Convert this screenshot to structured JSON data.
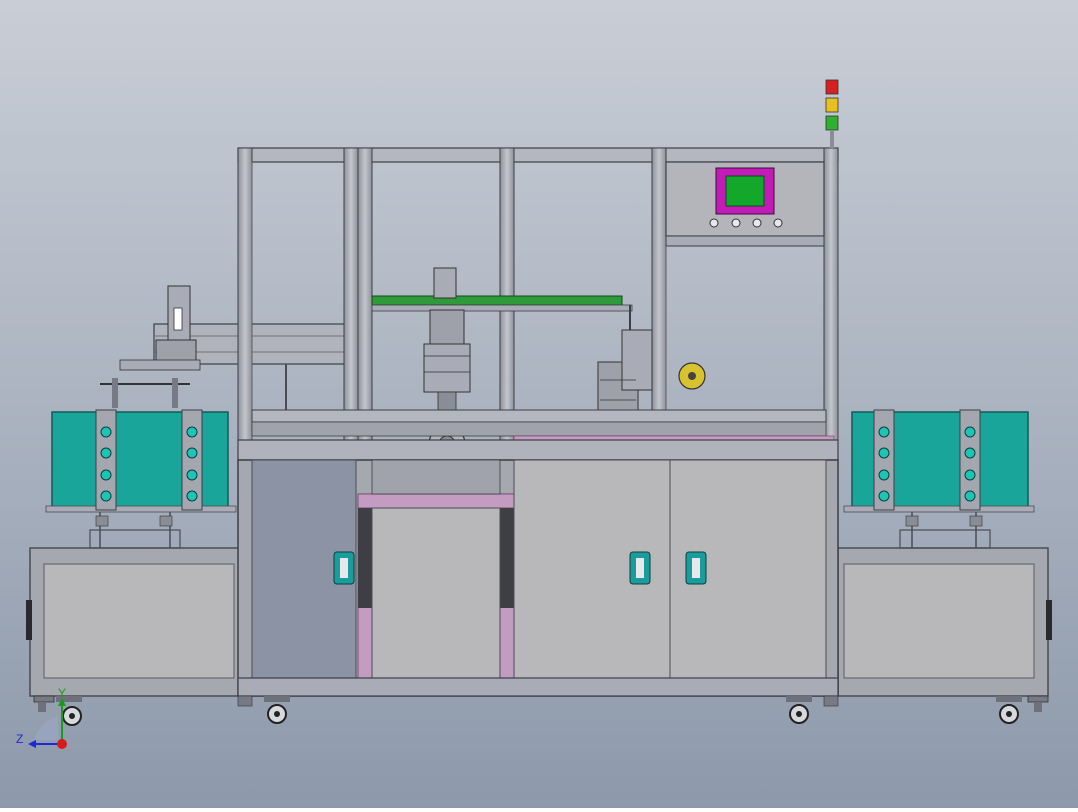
{
  "viewport": {
    "background_top": "#c9ced6",
    "background_bottom": "#8d99ab"
  },
  "colors": {
    "frame": "#a9acb6",
    "frame_dark": "#5a5d66",
    "panel_gray": "#b7b7b9",
    "panel_blue_gray": "#8c93a5",
    "teal_bin": "#1aa59b",
    "magenta": "#c21bb8",
    "screen_green": "#13a82b",
    "conveyor_green": "#2f9a3a",
    "pink_trim": "#c49bc1",
    "handle_teal": "#1a9c9c",
    "tape_yellow": "#d8c22e"
  },
  "hmi": {
    "screen": "green-screen",
    "buttons": 4
  },
  "signal_tower": {
    "lights": [
      "red",
      "yellow",
      "green"
    ],
    "light_colors": [
      "#d82020",
      "#e8c020",
      "#2fb02f"
    ]
  },
  "axis_triad": {
    "z_label": "Z",
    "y_label": "Y",
    "z_color": "#1a2ad8",
    "y_color": "#1a9a1a",
    "x_color": "#d81a1a"
  }
}
